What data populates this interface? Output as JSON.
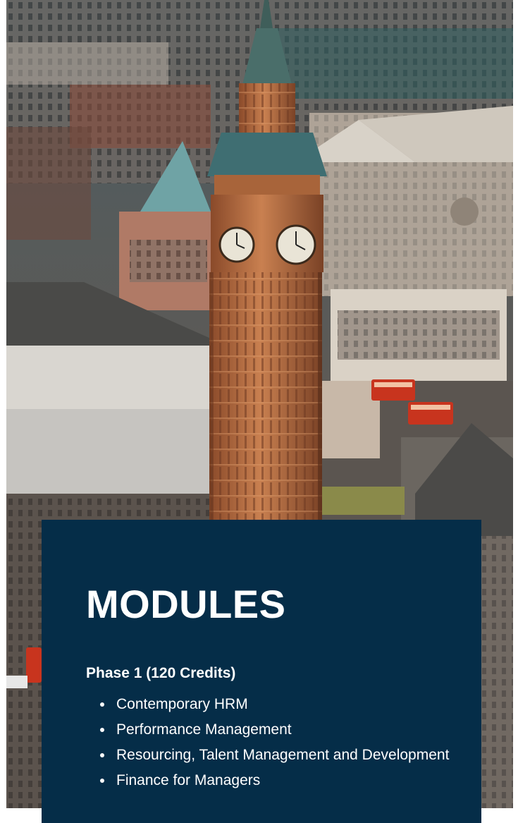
{
  "hero": {
    "image_semantic": "london-big-ben-aerial-photo",
    "colors": {
      "tower": "#B56A3E",
      "tower_dark": "#6E3B22",
      "roof": "#3F6E72",
      "clock_face": "#E9E4D6",
      "stone": "#CFC6B8",
      "bus": "#C8341E"
    }
  },
  "card": {
    "background": "#052D48",
    "title": "MODULES",
    "phase_heading": "Phase 1 (120 Credits)",
    "modules": [
      "Contemporary HRM",
      "Performance Management",
      "Resourcing, Talent Management and Development",
      "Finance for Managers"
    ]
  }
}
